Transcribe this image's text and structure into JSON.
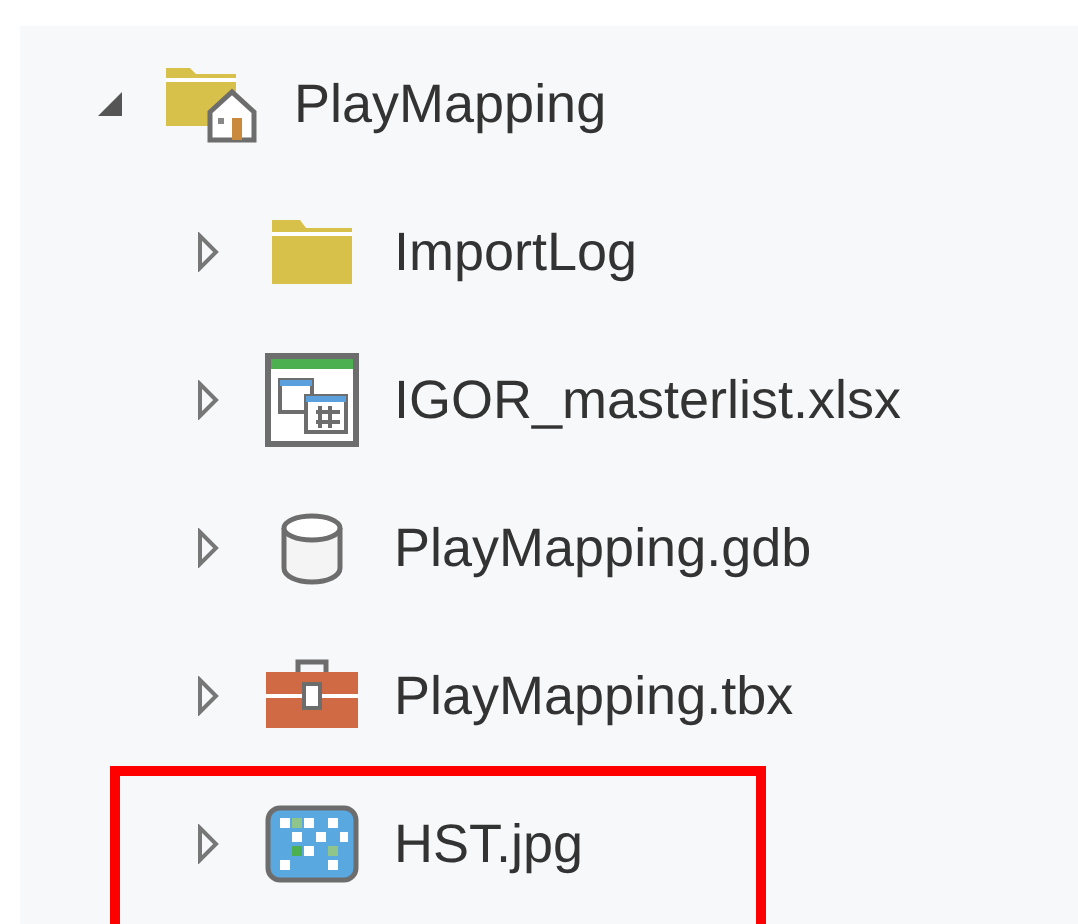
{
  "tree": {
    "label": "PlayMapping",
    "kind": "home-folder",
    "expanded": true,
    "highlighted": false,
    "children": [
      {
        "label": "ImportLog",
        "kind": "folder",
        "expanded": false,
        "highlighted": false
      },
      {
        "label": "IGOR_masterlist.xlsx",
        "kind": "spreadsheet",
        "expanded": false,
        "highlighted": false
      },
      {
        "label": "PlayMapping.gdb",
        "kind": "database",
        "expanded": false,
        "highlighted": false
      },
      {
        "label": "PlayMapping.tbx",
        "kind": "toolbox",
        "expanded": false,
        "highlighted": false
      },
      {
        "label": "HST.jpg",
        "kind": "image",
        "expanded": false,
        "highlighted": true
      }
    ]
  }
}
